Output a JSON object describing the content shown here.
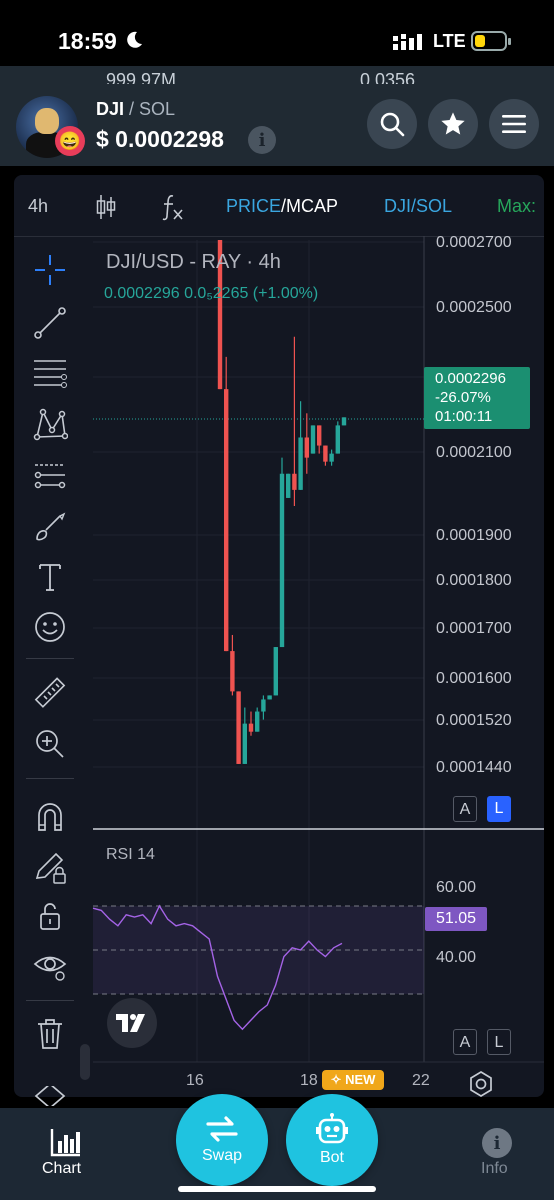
{
  "status_bar": {
    "time": "18:59",
    "network": "LTE"
  },
  "header": {
    "ghost_left": "999.97M",
    "ghost_right": "0.0356",
    "pair_base": "DJI",
    "pair_sep": " / ",
    "pair_quote": "SOL",
    "price": "$ 0.0002298",
    "info_glyph": "i",
    "emoji_glyph": "😄"
  },
  "toolbar": {
    "timeframe": "4h",
    "price_label": "PRICE",
    "mcap_label": "/MCAP",
    "pair_label": "DJI/SOL",
    "max_label": "Max:"
  },
  "chart": {
    "legend_title": "DJI/USD - RAY · 4h",
    "legend_values": "0.0002296  0.0₅2265 (+1.00%)",
    "price_axis": [
      "0.0002700",
      "0.0002500",
      "0.0002100",
      "0.0001900",
      "0.0001800",
      "0.0001700",
      "0.0001600",
      "0.0001520",
      "0.0001440"
    ],
    "current_price": "0.0002296",
    "current_change": "-26.07%",
    "current_countdown": "01:00:11",
    "btn_a": "A",
    "btn_l": "L",
    "rsi_label": "RSI 14",
    "rsi_axis": [
      "60.00",
      "40.00"
    ],
    "rsi_value": "51.05",
    "x_ticks": [
      "16",
      "18",
      "22"
    ],
    "new_badge": "✧ NEW"
  },
  "chart_data": {
    "type": "candlestick",
    "title": "DJI/USD - RAY · 4h",
    "ylim": [
      0.000142,
      0.000274
    ],
    "candles": [
      {
        "o": 0.000274,
        "h": 0.000274,
        "l": 0.000237,
        "c": 0.000237,
        "dir": "down"
      },
      {
        "o": 0.000237,
        "h": 0.000245,
        "l": 0.000172,
        "c": 0.000172,
        "dir": "down"
      },
      {
        "o": 0.000172,
        "h": 0.000176,
        "l": 0.000161,
        "c": 0.000162,
        "dir": "down"
      },
      {
        "o": 0.000162,
        "h": 0.000162,
        "l": 0.000144,
        "c": 0.000144,
        "dir": "down"
      },
      {
        "o": 0.000144,
        "h": 0.000158,
        "l": 0.000144,
        "c": 0.000154,
        "dir": "up"
      },
      {
        "o": 0.000154,
        "h": 0.000157,
        "l": 0.000151,
        "c": 0.000152,
        "dir": "down"
      },
      {
        "o": 0.000152,
        "h": 0.000158,
        "l": 0.000152,
        "c": 0.000157,
        "dir": "up"
      },
      {
        "o": 0.000157,
        "h": 0.000161,
        "l": 0.000155,
        "c": 0.00016,
        "dir": "up"
      },
      {
        "o": 0.00016,
        "h": 0.000161,
        "l": 0.00016,
        "c": 0.000161,
        "dir": "up"
      },
      {
        "o": 0.000161,
        "h": 0.000173,
        "l": 0.000161,
        "c": 0.000173,
        "dir": "up"
      },
      {
        "o": 0.000173,
        "h": 0.00022,
        "l": 0.000173,
        "c": 0.000216,
        "dir": "up"
      },
      {
        "o": 0.00021,
        "h": 0.000216,
        "l": 0.00021,
        "c": 0.000216,
        "dir": "up"
      },
      {
        "o": 0.000216,
        "h": 0.00025,
        "l": 0.000208,
        "c": 0.000212,
        "dir": "down"
      },
      {
        "o": 0.000212,
        "h": 0.000234,
        "l": 0.000212,
        "c": 0.000225,
        "dir": "up"
      },
      {
        "o": 0.000225,
        "h": 0.000231,
        "l": 0.000216,
        "c": 0.00022,
        "dir": "down"
      },
      {
        "o": 0.000221,
        "h": 0.000228,
        "l": 0.000221,
        "c": 0.000228,
        "dir": "up"
      },
      {
        "o": 0.000228,
        "h": 0.000228,
        "l": 0.000221,
        "c": 0.000223,
        "dir": "down"
      },
      {
        "o": 0.000223,
        "h": 0.000223,
        "l": 0.000218,
        "c": 0.000219,
        "dir": "down"
      },
      {
        "o": 0.000219,
        "h": 0.000222,
        "l": 0.000218,
        "c": 0.000221,
        "dir": "up"
      },
      {
        "o": 0.000221,
        "h": 0.000229,
        "l": 0.000221,
        "c": 0.000228,
        "dir": "up"
      },
      {
        "o": 0.000228,
        "h": 0.00023,
        "l": 0.000228,
        "c": 0.00023,
        "dir": "up"
      }
    ],
    "rsi": [
      69,
      68,
      64,
      61,
      66,
      65,
      66,
      62,
      70,
      64,
      61,
      62,
      61,
      58,
      55,
      38,
      28,
      18,
      14,
      18,
      22,
      25,
      34,
      47,
      51,
      50,
      54,
      50,
      47,
      51,
      53
    ],
    "rsi_levels": [
      70,
      50,
      30
    ],
    "colors": {
      "up": "#26a69a",
      "down": "#ef5350",
      "rsi": "#a463e6"
    }
  },
  "bottom_nav": {
    "chart_label": "Chart",
    "swap_label": "Swap",
    "bot_label": "Bot",
    "info_label": "Info",
    "info_glyph": "i"
  }
}
